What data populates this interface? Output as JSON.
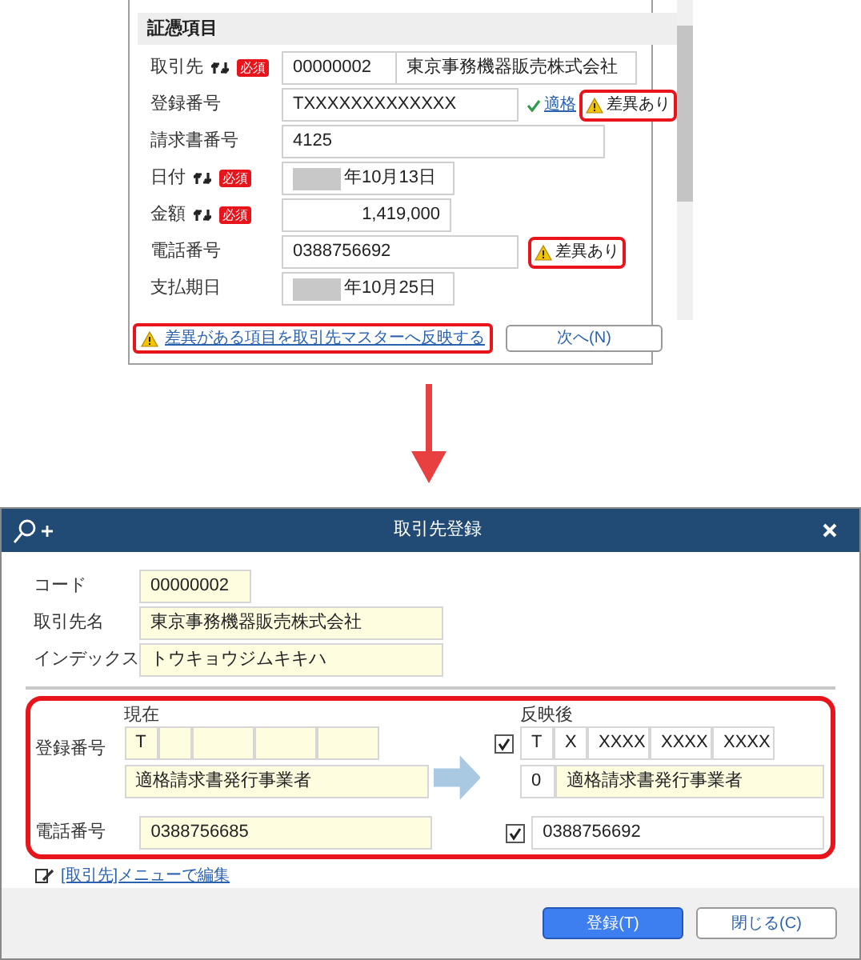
{
  "source_panel": {
    "section_title": "証憑項目",
    "rows": [
      {
        "kind": "pair",
        "label": "取引先",
        "sync": true,
        "required": "必須",
        "code": "00000002",
        "value": "東京事務機器販売株式会社"
      },
      {
        "kind": "text",
        "label": "登録番号",
        "sync": false,
        "value": "TXXXXXXXXXXXXX",
        "status": "適格",
        "flag": "差異あり"
      },
      {
        "kind": "wide",
        "label": "請求書番号",
        "sync": false,
        "value": "4125"
      },
      {
        "kind": "date",
        "label": "日付",
        "sync": true,
        "required": "必須",
        "value": "年10月13日"
      },
      {
        "kind": "amount",
        "label": "金額",
        "sync": true,
        "required": "必須",
        "value": "1,419,000"
      },
      {
        "kind": "text",
        "label": "電話番号",
        "sync": false,
        "value": "0388756692",
        "flag": "差異あり"
      },
      {
        "kind": "date",
        "label": "支払期日",
        "sync": false,
        "value": "年10月25日"
      }
    ],
    "reflect_link": "差異がある項目を取引先マスターへ反映する",
    "next_button": "次へ(N)"
  },
  "dialog": {
    "title": "取引先登録",
    "fields": [
      {
        "label": "コード",
        "value": "00000002",
        "kind": "short"
      },
      {
        "label": "取引先名",
        "value": "東京事務機器販売株式会社",
        "kind": "long"
      },
      {
        "label": "インデックス",
        "value": "トウキョウジムキキハ",
        "kind": "long"
      }
    ],
    "diff": {
      "current_heading": "現在",
      "after_heading": "反映後",
      "registration": {
        "label": "登録番号",
        "current_segments": [
          "T"
        ],
        "current_type": "適格請求書発行事業者",
        "checked": true,
        "after_segments": [
          "T",
          "X",
          "XXXX",
          "XXXX",
          "XXXX"
        ],
        "after_type_code": "0",
        "after_type": "適格請求書発行事業者"
      },
      "phone": {
        "label": "電話番号",
        "current": "0388756685",
        "checked": true,
        "after": "0388756692"
      }
    },
    "edit_link": "[取引先]メニューで編集",
    "buttons": [
      {
        "label": "登録(T)",
        "primary": true
      },
      {
        "label": "閉じる(C)",
        "primary": false
      }
    ]
  }
}
